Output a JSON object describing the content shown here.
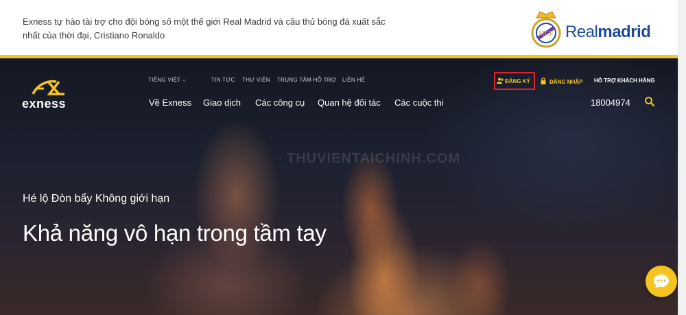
{
  "topbar": {
    "sponsor_text": "Exness tự hào tài trợ cho đội bóng số một thế giới Real Madrid và cầu thủ bóng đá xuất sắc nhất của thời đại, Cristiano Ronaldo",
    "partner_logo_a": "Real",
    "partner_logo_b": "madrid"
  },
  "header": {
    "brand": "exness",
    "language": "TIẾNG VIỆT",
    "top_links": [
      "TIN TỨC",
      "THƯ VIỆN",
      "TRUNG TÂM HỖ TRỢ",
      "LIÊN HỆ"
    ],
    "main_menu": [
      "Về Exness",
      "Giao dịch",
      "Các công cụ",
      "Quan hệ đối tác",
      "Các cuộc thi"
    ],
    "register": "ĐĂNG KÝ",
    "login": "ĐĂNG NHẬP",
    "support": "HỖ TRỢ KHÁCH HÀNG",
    "phone": "18004974"
  },
  "hero": {
    "subtitle": "Hé lộ Đòn bẩy Không giới hạn",
    "title": "Khả năng vô hạn trong tầm tay",
    "watermark": "THUVIENTAICHINH.COM"
  },
  "colors": {
    "accent": "#f6c421",
    "highlight_box": "#e0202a",
    "realmadrid_blue": "#1c4b9c"
  },
  "icons": [
    "real-madrid-crest-icon",
    "exness-logo-icon",
    "chevron-down-icon",
    "user-plus-icon",
    "lock-icon",
    "search-icon",
    "chat-icon"
  ]
}
